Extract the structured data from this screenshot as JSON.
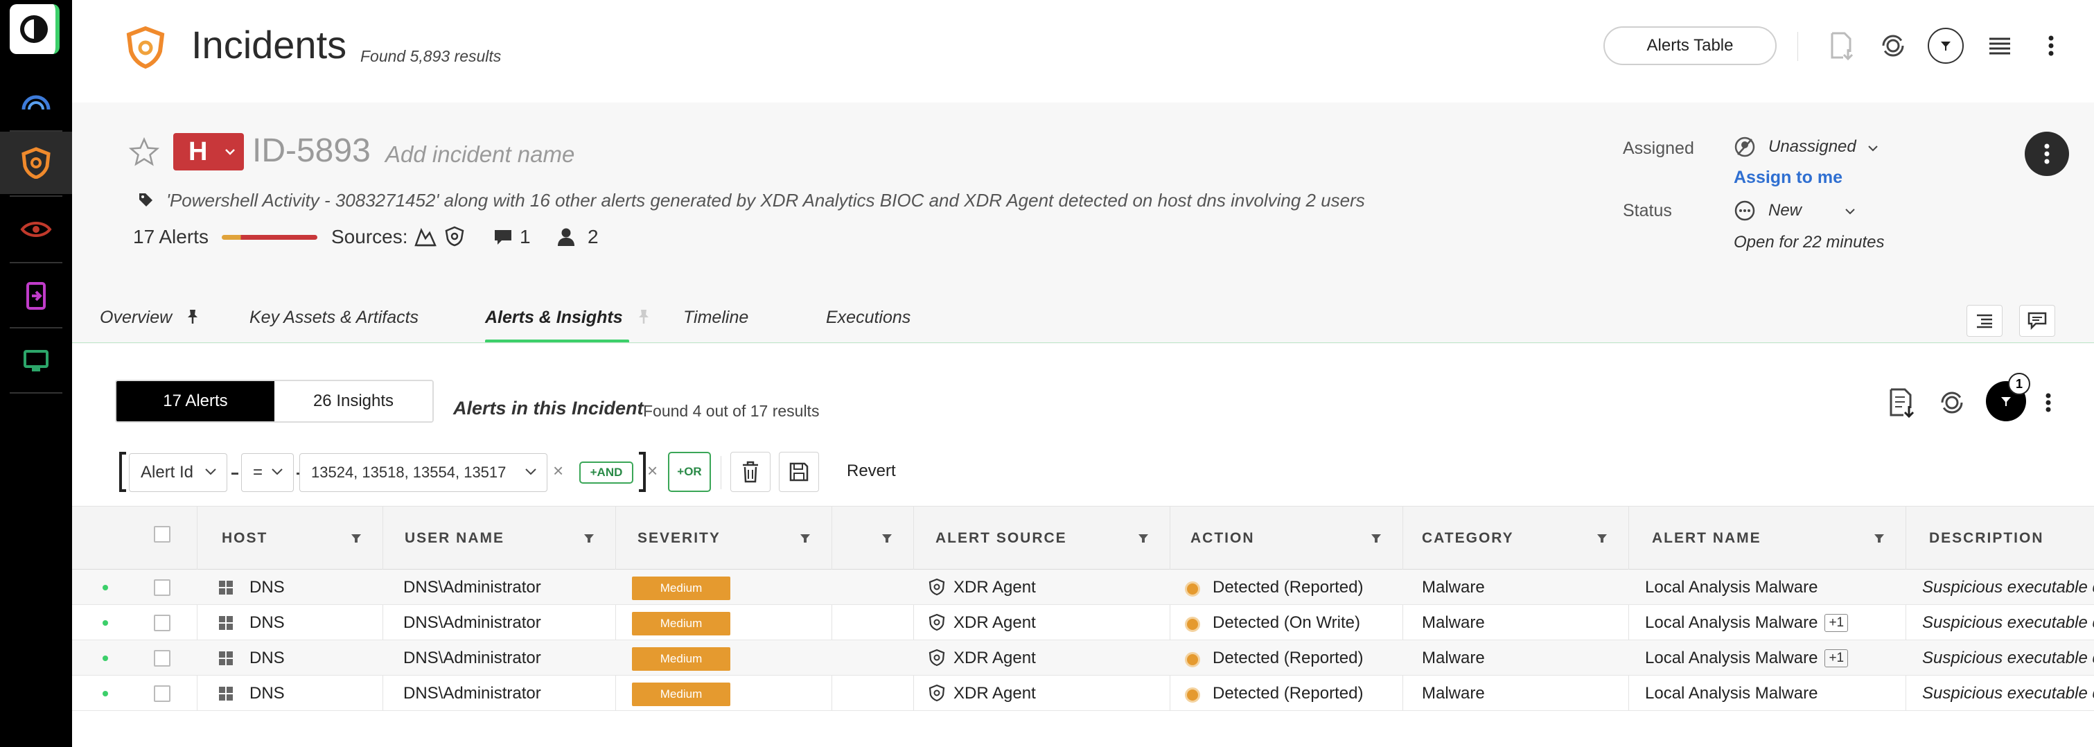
{
  "header": {
    "title": "Incidents",
    "count": "Found 5,893 results",
    "alerts_table_label": "Alerts Table"
  },
  "incident": {
    "severity": "H",
    "id": "ID-5893",
    "name_placeholder": "Add incident name",
    "description": "'Powershell Activity - 3083271452' along with 16 other alerts generated by XDR Analytics BIOC and XDR Agent detected on host dns involving 2 users",
    "alerts_count": "17 Alerts",
    "sources_label": "Sources:",
    "comments_count": "1",
    "users_count": "2",
    "assigned_label": "Assigned",
    "assigned_value": "Unassigned",
    "assign_to_me": "Assign to me",
    "status_label": "Status",
    "status_value": "New",
    "open_for": "Open for 22 minutes"
  },
  "tabs": [
    {
      "label": "Overview"
    },
    {
      "label": "Key Assets & Artifacts"
    },
    {
      "label": "Alerts & Insights"
    },
    {
      "label": "Timeline"
    },
    {
      "label": "Executions"
    }
  ],
  "alerts_section": {
    "seg_alerts": "17 Alerts",
    "seg_insights": "26 Insights",
    "title": "Alerts in this Incident",
    "count": "Found 4 out of 17 results",
    "active_filters": "1"
  },
  "filter": {
    "field": "Alert Id",
    "operator": "=",
    "value": "13524, 13518, 13554, 13517",
    "and_label": "+AND",
    "or_label": "+OR",
    "revert_label": "Revert"
  },
  "table": {
    "columns": [
      "HOST",
      "USER NAME",
      "SEVERITY",
      "ALERT SOURCE",
      "ACTION",
      "CATEGORY",
      "ALERT NAME",
      "DESCRIPTION"
    ],
    "rows": [
      {
        "host": "DNS",
        "user": "DNS\\Administrator",
        "severity": "Medium",
        "source": "XDR Agent",
        "action": "Detected (Reported)",
        "category": "Malware",
        "alert_name": "Local Analysis Malware",
        "extra": "",
        "description": "Suspicious executable detected"
      },
      {
        "host": "DNS",
        "user": "DNS\\Administrator",
        "severity": "Medium",
        "source": "XDR Agent",
        "action": "Detected (On Write)",
        "category": "Malware",
        "alert_name": "Local Analysis Malware",
        "extra": "+1",
        "description": "Suspicious executable detected"
      },
      {
        "host": "DNS",
        "user": "DNS\\Administrator",
        "severity": "Medium",
        "source": "XDR Agent",
        "action": "Detected (Reported)",
        "category": "Malware",
        "alert_name": "Local Analysis Malware",
        "extra": "+1",
        "description": "Suspicious executable detected"
      },
      {
        "host": "DNS",
        "user": "DNS\\Administrator",
        "severity": "Medium",
        "source": "XDR Agent",
        "action": "Detected (Reported)",
        "category": "Malware",
        "alert_name": "Local Analysis Malware",
        "extra": "",
        "description": "Suspicious executable detected"
      }
    ]
  },
  "colors": {
    "accent_green": "#3ccf6a",
    "severity_high": "#c8373a",
    "severity_medium": "#e59a2f",
    "link_blue": "#2f6fd1"
  }
}
